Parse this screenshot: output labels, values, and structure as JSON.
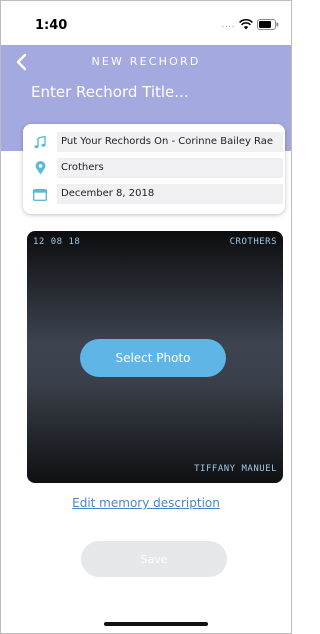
{
  "status_bar": {
    "time": "1:40",
    "signal": "....",
    "wifi_icon": "wifi-icon",
    "battery_icon": "battery-icon"
  },
  "header": {
    "title": "NEW RECHORD",
    "back_icon": "chevron-left-icon",
    "background": "#a4a9e0"
  },
  "title_field": {
    "placeholder": "Enter Rechord Title...",
    "value": ""
  },
  "info": {
    "song": {
      "icon": "music-note-icon",
      "value": "Put Your Rechords On - Corinne Bailey Rae"
    },
    "location": {
      "icon": "location-pin-icon",
      "value": "Crothers"
    },
    "date": {
      "icon": "calendar-icon",
      "value": "December 8, 2018"
    }
  },
  "photo": {
    "date_stamp": "12 08 18",
    "location_stamp": "CROTHERS",
    "name_stamp": "TIFFANY MANUEL",
    "select_label": "Select Photo"
  },
  "edit_memory_label": "Edit memory description",
  "save_label": "Save",
  "colors": {
    "accent": "#a4a9e0",
    "button_blue": "#5fb6e6",
    "link": "#4a86c7",
    "icon_teal": "#5bbbd6"
  }
}
